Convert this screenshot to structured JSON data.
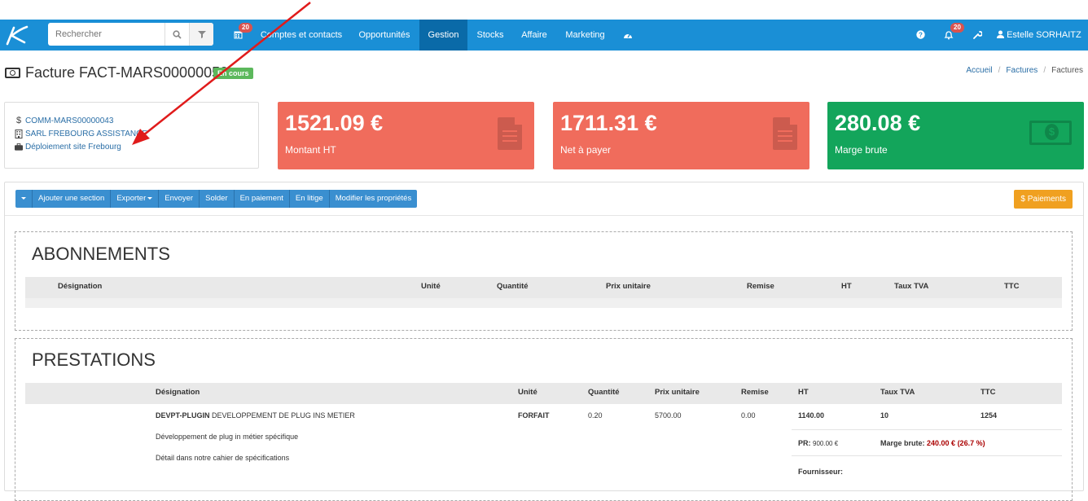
{
  "navbar": {
    "search_placeholder": "Rechercher",
    "items": [
      {
        "label": "Comptes et contacts"
      },
      {
        "label": "Opportunités"
      },
      {
        "label": "Gestion"
      },
      {
        "label": "Stocks"
      },
      {
        "label": "Affaire"
      },
      {
        "label": "Marketing"
      }
    ],
    "calendar_badge": "20",
    "notifications_badge": "20",
    "user_name": "Estelle SORHAITZ",
    "colors": {
      "bar": "#1a8fd6",
      "active": "#0a6aa8"
    }
  },
  "page": {
    "title": "Facture FACT-MARS00000050",
    "status": "En cours",
    "breadcrumb": [
      "Accueil",
      "Factures",
      "Factures"
    ]
  },
  "info": {
    "order_ref": "COMM-MARS00000043",
    "company": "SARL FREBOURG ASSISTANCE",
    "project": "Déploiement site Frebourg"
  },
  "cards": [
    {
      "value": "1521.09 €",
      "label": "Montant HT",
      "color": "#f06c5c",
      "icon": "document-icon"
    },
    {
      "value": "1711.31 €",
      "label": "Net à payer",
      "color": "#f06c5c",
      "icon": "document-icon"
    },
    {
      "value": "280.08 €",
      "label": "Marge brute",
      "color": "#13a55b",
      "icon": "money-icon"
    }
  ],
  "toolbar": {
    "add_section": "Ajouter une section",
    "export": "Exporter",
    "send": "Envoyer",
    "settle": "Solder",
    "in_payment": "En paiement",
    "in_dispute": "En litige",
    "edit_props": "Modifier les propriétés",
    "payments": "$ Paiements"
  },
  "abonnements": {
    "title": "ABONNEMENTS",
    "columns": [
      "Désignation",
      "Unité",
      "Quantité",
      "Prix unitaire",
      "Remise",
      "HT",
      "Taux TVA",
      "TTC"
    ]
  },
  "prestations": {
    "title": "PRESTATIONS",
    "columns": [
      "Désignation",
      "Unité",
      "Quantité",
      "Prix unitaire",
      "Remise",
      "HT",
      "Taux TVA",
      "TTC"
    ],
    "row": {
      "code": "DEVPT-PLUGIN",
      "name": "DEVELOPPEMENT DE PLUG INS METIER",
      "desc1": "Développement de plug in métier spécifique",
      "desc2": "Détail dans notre cahier de spécifications",
      "unit": "FORFAIT",
      "qty": "0.20",
      "unit_price": "5700.00",
      "discount": "0.00",
      "ht": "1140.00",
      "vat": "10",
      "ttc": "1254",
      "pr_label": "PR:",
      "pr_value": "900.00 €",
      "margin_label": "Marge brute:",
      "margin_value": "240.00 € (26.7 %)",
      "supplier_label": "Fournisseur:"
    }
  }
}
